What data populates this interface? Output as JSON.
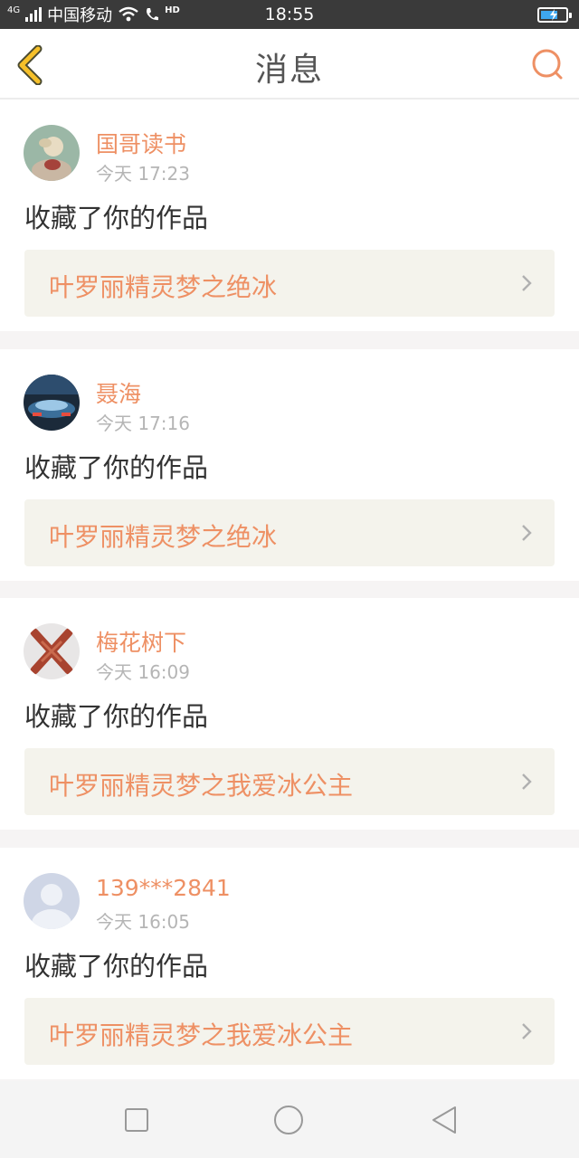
{
  "status_bar": {
    "network": "4G",
    "carrier": "中国移动",
    "hd_label": "HD",
    "time": "18:55"
  },
  "nav": {
    "title": "消息",
    "back_icon": "back-chevron-icon",
    "search_icon": "search-icon"
  },
  "colors": {
    "accent": "#ee9064",
    "back_icon": "#f6c02a",
    "work_card_bg": "#f4f3ec",
    "timestamp": "#b5b5b5"
  },
  "messages": [
    {
      "user": "国哥读书",
      "time": "今天 17:23",
      "action": "收藏了你的作品",
      "work": "叶罗丽精灵梦之绝冰"
    },
    {
      "user": "聂海",
      "time": "今天 17:16",
      "action": "收藏了你的作品",
      "work": "叶罗丽精灵梦之绝冰"
    },
    {
      "user": "梅花树下",
      "time": "今天 16:09",
      "action": "收藏了你的作品",
      "work": "叶罗丽精灵梦之我爱冰公主"
    },
    {
      "user": "139***2841",
      "time": "今天 16:05",
      "action": "收藏了你的作品",
      "work": "叶罗丽精灵梦之我爱冰公主"
    }
  ],
  "system_nav": {
    "recents": "square-recents-icon",
    "home": "circle-home-icon",
    "back": "triangle-back-icon"
  }
}
